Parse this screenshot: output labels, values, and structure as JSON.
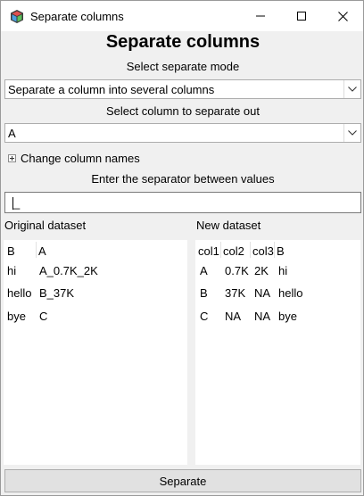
{
  "window": {
    "title": "Separate columns",
    "minimize_glyph": "—",
    "maximize_glyph": "☐",
    "close_glyph": "✕"
  },
  "heading": "Separate columns",
  "mode": {
    "label": "Select separate mode",
    "selected": "Separate a column into several columns"
  },
  "column": {
    "label": "Select column to separate out",
    "selected": "A"
  },
  "change_names": {
    "label": "Change column names"
  },
  "separator": {
    "label": "Enter the separator between values",
    "value": "_"
  },
  "original": {
    "label": "Original dataset",
    "headers": [
      "B",
      "A"
    ],
    "rows": [
      [
        "hi",
        "A_0.7K_2K"
      ],
      [
        "hello",
        "B_37K"
      ],
      [
        "bye",
        "C"
      ]
    ]
  },
  "new": {
    "label": "New dataset",
    "headers": [
      "col1",
      "col2",
      "col3",
      "B"
    ],
    "rows": [
      [
        "A",
        "0.7K",
        "2K",
        "hi"
      ],
      [
        "B",
        "37K",
        "NA",
        "hello"
      ],
      [
        "C",
        "NA",
        "NA",
        "bye"
      ]
    ]
  },
  "button": {
    "separate": "Separate"
  },
  "colors": {
    "window_bg": "#f0f0f0",
    "titlebar_bg": "#ffffff",
    "input_bg": "#ffffff",
    "button_bg": "#e1e1e1"
  }
}
